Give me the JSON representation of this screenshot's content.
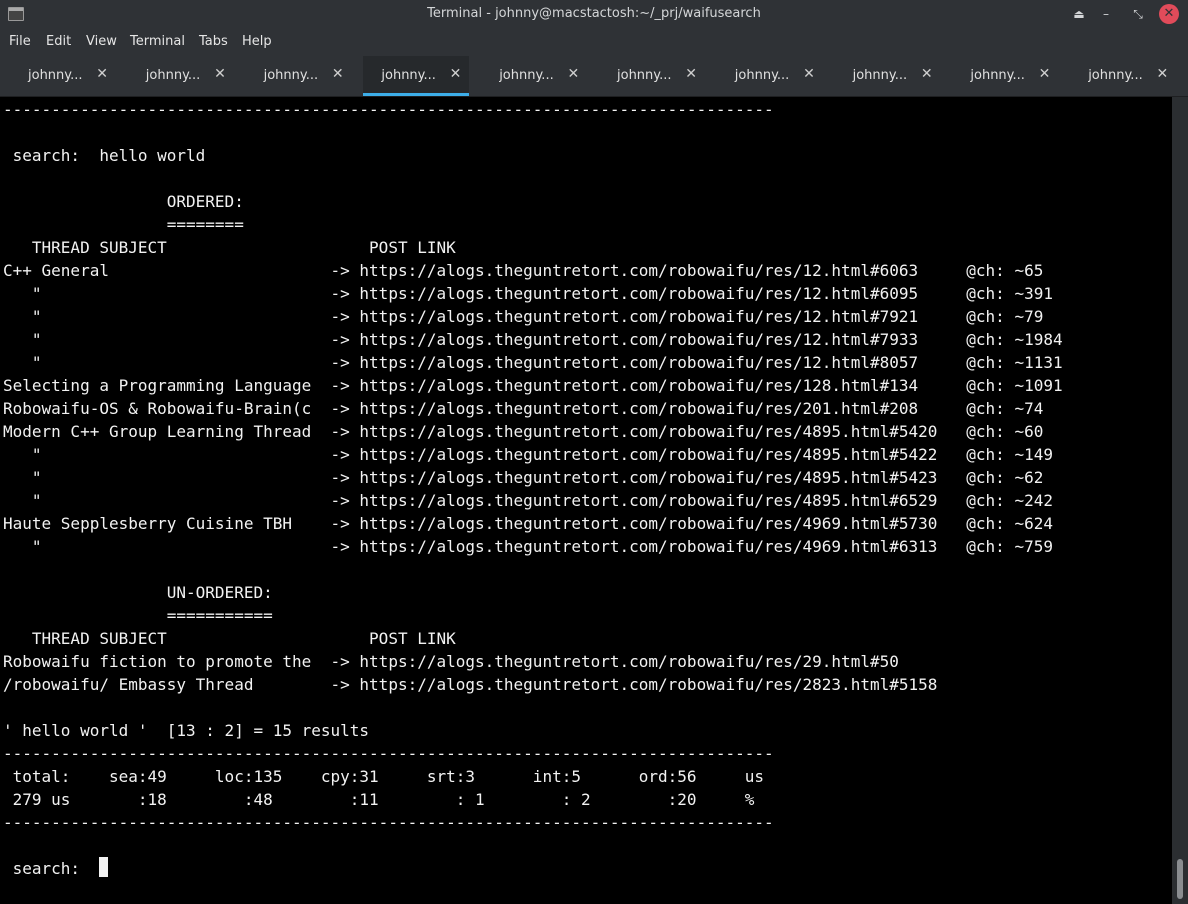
{
  "window": {
    "title": "Terminal - johnny@macstactosh:~/_prj/waifusearch",
    "controls": {
      "shade": "⏏",
      "minimize": "–",
      "restore": "⤡",
      "close": "✕"
    }
  },
  "menu": [
    "File",
    "Edit",
    "View",
    "Terminal",
    "Tabs",
    "Help"
  ],
  "tabs": [
    {
      "label": "johnny..."
    },
    {
      "label": "johnny..."
    },
    {
      "label": "johnny..."
    },
    {
      "label": "johnny..."
    },
    {
      "label": "johnny..."
    },
    {
      "label": "johnny..."
    },
    {
      "label": "johnny..."
    },
    {
      "label": "johnny..."
    },
    {
      "label": "johnny..."
    },
    {
      "label": "johnny..."
    }
  ],
  "tab_close_glyph": "✕",
  "active_tab_index": 3,
  "terminal": {
    "lines": [
      "--------------------------------------------------------------------------------",
      "",
      " search:  hello world",
      "",
      "                 ORDERED:",
      "                 ========",
      "   THREAD SUBJECT                     POST LINK",
      "C++ General                       -> https://alogs.theguntretort.com/robowaifu/res/12.html#6063     @ch: ~65",
      "   \"                              -> https://alogs.theguntretort.com/robowaifu/res/12.html#6095     @ch: ~391",
      "   \"                              -> https://alogs.theguntretort.com/robowaifu/res/12.html#7921     @ch: ~79",
      "   \"                              -> https://alogs.theguntretort.com/robowaifu/res/12.html#7933     @ch: ~1984",
      "   \"                              -> https://alogs.theguntretort.com/robowaifu/res/12.html#8057     @ch: ~1131",
      "Selecting a Programming Language  -> https://alogs.theguntretort.com/robowaifu/res/128.html#134     @ch: ~1091",
      "Robowaifu-OS & Robowaifu-Brain(c  -> https://alogs.theguntretort.com/robowaifu/res/201.html#208     @ch: ~74",
      "Modern C++ Group Learning Thread  -> https://alogs.theguntretort.com/robowaifu/res/4895.html#5420   @ch: ~60",
      "   \"                              -> https://alogs.theguntretort.com/robowaifu/res/4895.html#5422   @ch: ~149",
      "   \"                              -> https://alogs.theguntretort.com/robowaifu/res/4895.html#5423   @ch: ~62",
      "   \"                              -> https://alogs.theguntretort.com/robowaifu/res/4895.html#6529   @ch: ~242",
      "Haute Sepplesberry Cuisine TBH    -> https://alogs.theguntretort.com/robowaifu/res/4969.html#5730   @ch: ~624",
      "   \"                              -> https://alogs.theguntretort.com/robowaifu/res/4969.html#6313   @ch: ~759",
      "",
      "                 UN-ORDERED:",
      "                 ===========",
      "   THREAD SUBJECT                     POST LINK",
      "Robowaifu fiction to promote the  -> https://alogs.theguntretort.com/robowaifu/res/29.html#50",
      "/robowaifu/ Embassy Thread        -> https://alogs.theguntretort.com/robowaifu/res/2823.html#5158",
      "",
      "' hello world '  [13 : 2] = 15 results",
      "--------------------------------------------------------------------------------",
      " total:    sea:49     loc:135    cpy:31     srt:3      int:5      ord:56     us",
      " 279 us       :18        :48        :11        : 1        : 2        :20     %",
      "--------------------------------------------------------------------------------",
      "",
      " search:  "
    ]
  }
}
